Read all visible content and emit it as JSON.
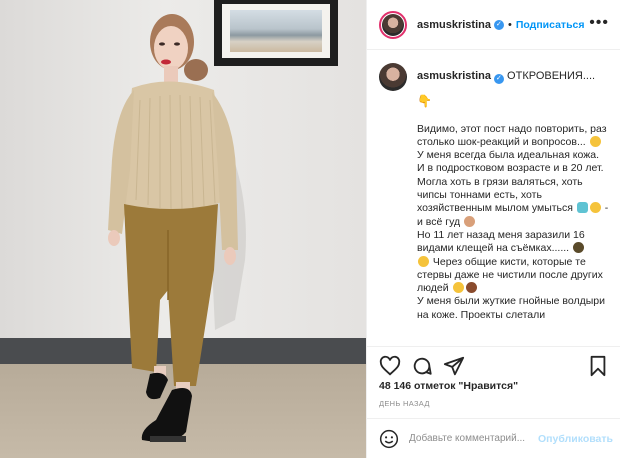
{
  "post": {
    "author": "asmuskristina",
    "follow_label": "Подписаться",
    "header_separator": "•",
    "more_label": "•••",
    "caption_title": "ОТКРОВЕНИЯ....",
    "caption_lines": [
      "Видимо, этот пост надо повторить, раз столько шок-реакций и вопросов... ",
      "У меня всегда была идеальная кожа. И в подростковом возрасте и в 20 лет. Могла хоть в грязи валяться, хоть чипсы тоннами есть, хоть хозяйственным мылом умыться ",
      " - и всё гуд ",
      "Но 11 лет назад меня заразили 16 видами клещей на съёмках...... ",
      " Через общие кисти, которые те стервы даже не чистили после других людей ",
      "У меня были жуткие гнойные волдыри на коже. Проекты слетали"
    ],
    "likes_count": "48 146",
    "likes_word": "отметок",
    "likes_suffix": "\"Нравится\"",
    "time_ago": "ДЕНЬ НАЗАД"
  },
  "comment_box": {
    "placeholder": "Добавьте комментарий...",
    "post_label": "Опубликовать"
  },
  "icons": {
    "verified": "verified-badge-icon",
    "like": "heart-icon",
    "comment": "comment-icon",
    "share": "paper-plane-icon",
    "save": "bookmark-icon",
    "emoji": "smiley-icon",
    "pointing": "pointing-down-hand-icon"
  },
  "colors": {
    "accent": "#0095f6",
    "verified": "#3897f0",
    "post_disabled": "#b2dffc",
    "story_ring": "#e1306c"
  }
}
